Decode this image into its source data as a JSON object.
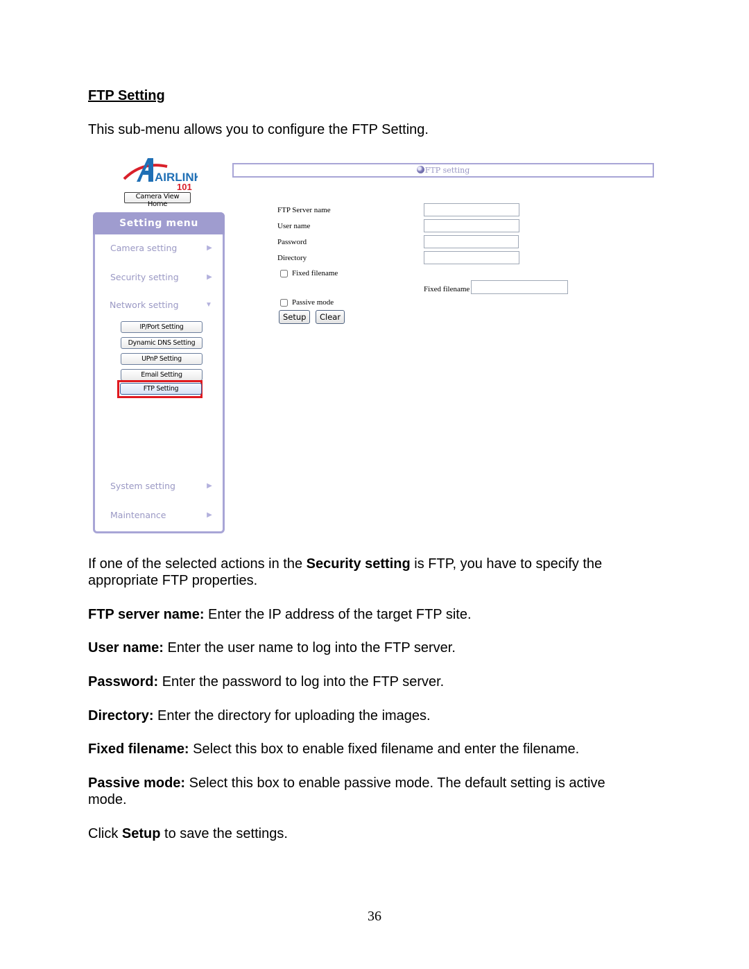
{
  "document": {
    "section_title": "FTP Setting",
    "intro": "This sub-menu allows you to configure the FTP Setting.",
    "page_number": "36"
  },
  "screenshot": {
    "logo": {
      "brand": "AIRLINK",
      "sub": "101"
    },
    "camera_view_home_label": "Camera View Home",
    "menu": {
      "title": "Setting menu",
      "items": [
        {
          "label": "Camera setting",
          "arrow": "▶"
        },
        {
          "label": "Security setting",
          "arrow": "▶"
        },
        {
          "label": "Network setting",
          "arrow": "▼"
        },
        {
          "label": "System setting",
          "arrow": "▶"
        },
        {
          "label": "Maintenance",
          "arrow": "▶"
        }
      ],
      "network_submenu": [
        {
          "label": "IP/Port Setting"
        },
        {
          "label": "Dynamic DNS Setting"
        },
        {
          "label": "UPnP Setting"
        },
        {
          "label": "Email Setting"
        },
        {
          "label": "FTP Setting",
          "active": true
        }
      ]
    },
    "panel_title": "FTP setting",
    "form": {
      "fields": [
        {
          "label": "FTP Server name",
          "value": ""
        },
        {
          "label": "User name",
          "value": ""
        },
        {
          "label": "Password",
          "value": ""
        },
        {
          "label": "Directory",
          "value": ""
        }
      ],
      "fixed_filename_checkbox": {
        "label": "Fixed filename",
        "checked": false
      },
      "fixed_filename_field": {
        "label": "Fixed filename",
        "value": ""
      },
      "passive_mode_checkbox": {
        "label": "Passive mode",
        "checked": false
      },
      "setup_label": "Setup",
      "clear_label": "Clear"
    },
    "colors": {
      "menu_accent": "#9f9ccf",
      "menu_text": "#9a98c4",
      "highlight": "#e0191f"
    }
  },
  "paragraphs": [
    {
      "pre": "If one of the selected actions in the ",
      "bold": "Security setting",
      "post": " is FTP, you have to specify the appropriate FTP properties."
    },
    {
      "bold": "FTP server name:",
      "post": " Enter the IP address of the target FTP site."
    },
    {
      "bold": "User name:",
      "post": " Enter the user name to log into the FTP server."
    },
    {
      "bold": "Password:",
      "post": " Enter the password to log into the FTP server."
    },
    {
      "bold": "Directory:",
      "post": " Enter the directory for uploading the images."
    },
    {
      "bold": "Fixed filename:",
      "post": " Select this box to enable fixed filename and enter the filename."
    },
    {
      "bold": "Passive mode:",
      "post": " Select this box to enable passive mode. The default setting is active mode."
    },
    {
      "pre": "Click ",
      "bold": "Setup",
      "post": " to save the settings."
    }
  ]
}
